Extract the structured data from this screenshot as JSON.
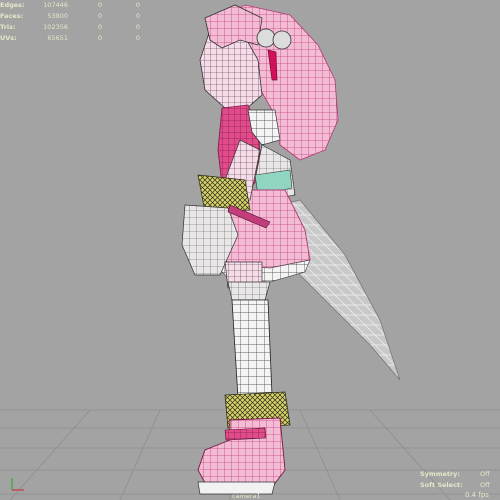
{
  "stats": {
    "rows": [
      {
        "label": "Edges:",
        "value": "107446",
        "col2": "0",
        "col3": "0"
      },
      {
        "label": "Faces:",
        "value": "53800",
        "col2": "0",
        "col3": "0"
      },
      {
        "label": "Tris:",
        "value": "102356",
        "col2": "0",
        "col3": "0"
      },
      {
        "label": "UVs:",
        "value": "65651",
        "col2": "0",
        "col3": "0"
      }
    ]
  },
  "hud": {
    "symmetry_label": "Symmetry:",
    "symmetry_value": "Off",
    "soft_select_label": "Soft Select:",
    "soft_select_value": "Off",
    "fps": "0.4 fps",
    "camera": "camera1"
  },
  "colors": {
    "background": "#a3a3a3",
    "grid": "#8e8e8e",
    "wire_pink": "#e35c9a",
    "hud_text": "#e6e6c8"
  }
}
